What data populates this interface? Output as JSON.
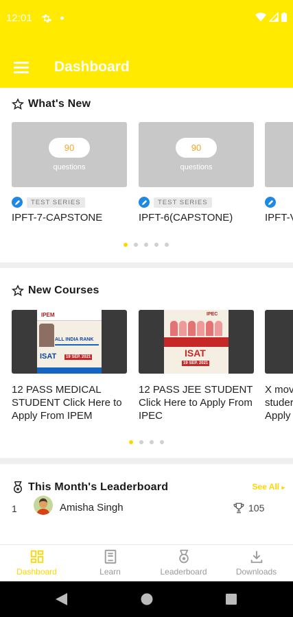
{
  "status": {
    "time": "12:01"
  },
  "header": {
    "title": "Dashboard"
  },
  "whats_new": {
    "title": "What's New",
    "cards": [
      {
        "count": "90",
        "caption": "questions",
        "tag": "TEST SERIES",
        "title": "IPFT-7-CAPSTONE"
      },
      {
        "count": "90",
        "caption": "questions",
        "tag": "TEST SERIES",
        "title": "IPFT-6(CAPSTONE)"
      },
      {
        "count": "",
        "caption": "",
        "tag": "",
        "title": "IPFT-V"
      }
    ]
  },
  "new_courses": {
    "title": "New Courses",
    "cards": [
      {
        "title": "12 PASS MEDICAL STUDENT Click Here to Apply From IPEM",
        "poster_brand": "IPEM",
        "poster_text": "ALL INDIA RANK",
        "poster_sub": "ISAT",
        "poster_date": "19 SEP. 2021"
      },
      {
        "title": "12 PASS JEE STUDENT Click Here to Apply From IPEC",
        "poster_brand": "IPEC",
        "poster_text": "",
        "poster_sub": "ISAT",
        "poster_date": "19 SEP. 2021"
      },
      {
        "title": "X mov studer Apply",
        "poster_brand": "",
        "poster_text": "",
        "poster_sub": "",
        "poster_date": ""
      }
    ]
  },
  "leaderboard": {
    "title": "This Month's Leaderboard",
    "see_all": "See All",
    "rows": [
      {
        "rank": "1",
        "name": "Amisha Singh",
        "score": "105"
      }
    ]
  },
  "bottom_nav": [
    {
      "label": "Dashboard",
      "icon": "dashboard-icon",
      "active": true
    },
    {
      "label": "Learn",
      "icon": "book-icon",
      "active": false
    },
    {
      "label": "Leaderboard",
      "icon": "medal-icon",
      "active": false
    },
    {
      "label": "Downloads",
      "icon": "download-icon",
      "active": false
    }
  ],
  "colors": {
    "accent": "#ffea00",
    "active": "#ffd600",
    "tag_blue": "#1e88e5",
    "pill_text": "#f5a623"
  }
}
